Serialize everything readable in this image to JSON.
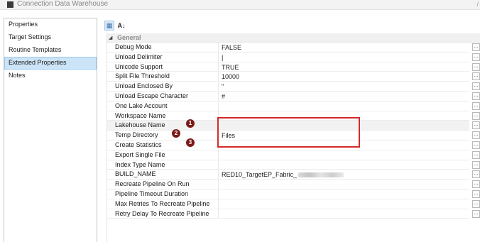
{
  "window": {
    "title": "Connection Data Warehouse",
    "corner_mark": "/"
  },
  "nav": {
    "items": [
      {
        "label": "Properties",
        "selected": false
      },
      {
        "label": "Target Settings",
        "selected": false
      },
      {
        "label": "Routine Templates",
        "selected": false
      },
      {
        "label": "Extended Properties",
        "selected": true
      },
      {
        "label": "Notes",
        "selected": false
      }
    ]
  },
  "toolbar": {
    "categorized_icon": "categorized-icon",
    "categorized_glyph": "▦",
    "alphabetical_icon": "sort-az-icon",
    "alphabetical_glyph": "A↓"
  },
  "grid": {
    "category": {
      "label": "General",
      "toggle": "◢"
    },
    "ellipsis_label": "...",
    "rows": [
      {
        "name": "Debug Mode",
        "value": "FALSE"
      },
      {
        "name": "Unload Delimiter",
        "value": "|"
      },
      {
        "name": "Unicode Support",
        "value": "TRUE"
      },
      {
        "name": "Split File Threshold",
        "value": "10000"
      },
      {
        "name": "Unload Enclosed By",
        "value": "\""
      },
      {
        "name": "Unload Escape Character",
        "value": "#"
      },
      {
        "name": "One Lake Account",
        "value": ""
      },
      {
        "name": "Workspace Name",
        "value": ""
      },
      {
        "name": "Lakehouse Name",
        "value": ""
      },
      {
        "name": "Temp Directory",
        "value": "Files"
      },
      {
        "name": "Create Statistics",
        "value": ""
      },
      {
        "name": "Export Single File",
        "value": ""
      },
      {
        "name": "Index Type Name",
        "value": ""
      },
      {
        "name": "BUILD_NAME",
        "value": "RED10_TargetEP_Fabric_"
      },
      {
        "name": "Recreate Pipeline On Run",
        "value": ""
      },
      {
        "name": "Pipeline Timeout Duration",
        "value": ""
      },
      {
        "name": "Max Retries To Recreate Pipeline",
        "value": ""
      },
      {
        "name": "Retry Delay To Recreate Pipeline",
        "value": ""
      }
    ]
  },
  "annotations": {
    "highlight_color": "#d42a2a",
    "marker_color": "#7b1a1a",
    "markers": [
      "1",
      "2",
      "3"
    ]
  }
}
